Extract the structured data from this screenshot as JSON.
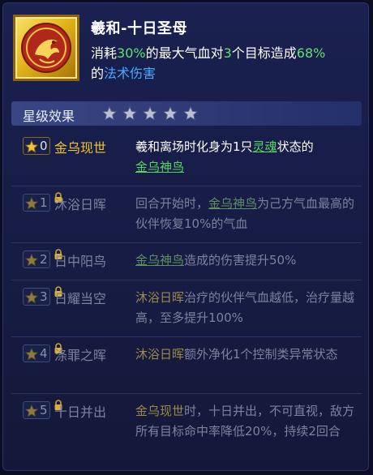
{
  "skill": {
    "icon": "phoenix-emblem-icon",
    "title": "羲和-十日圣母",
    "desc": {
      "p1": "消耗",
      "p2": "30%",
      "p3": "的最大气血对",
      "p4": "3",
      "p5": "个目标造成",
      "p6": "68%",
      "p7": "的",
      "p8": "法术伤害"
    }
  },
  "section": {
    "title": "星级效果",
    "stars_total": 5,
    "stars_icon": "star-icon"
  },
  "rows": [
    {
      "star": "0",
      "name": "金乌现世",
      "locked": false,
      "d1": "羲和离场时化身为1只",
      "d2": "灵魂",
      "d3": "状态的",
      "d4": "金乌神鸟"
    },
    {
      "star": "1",
      "name": "沐浴日晖",
      "locked": true,
      "d1": "回合开始时，",
      "d2": "金乌神鸟",
      "d3": "为己方气血最高的伙伴恢复10%的气血"
    },
    {
      "star": "2",
      "name": "日中阳鸟",
      "locked": true,
      "d1": "金乌神鸟",
      "d2": "造成的伤害提升50%"
    },
    {
      "star": "3",
      "name": "日耀当空",
      "locked": true,
      "d1": "沐浴日晖",
      "d2": "治疗的伙伴气血越低，治疗量越高，至多提升100%"
    },
    {
      "star": "4",
      "name": "涤罪之晖",
      "locked": true,
      "d1": "沐浴日晖",
      "d2": "额外净化1个控制类异常状态"
    },
    {
      "star": "5",
      "name": "十日并出",
      "locked": true,
      "d1": "金乌现世",
      "d2": "时，十日并出，不可直视，敌方所有目标命中率降低20%，持续2回合"
    }
  ],
  "colors": {
    "gold": "#f0c231",
    "green": "#5ee36c",
    "blue": "#48a9ff",
    "locked_gray": "#7d829e"
  }
}
